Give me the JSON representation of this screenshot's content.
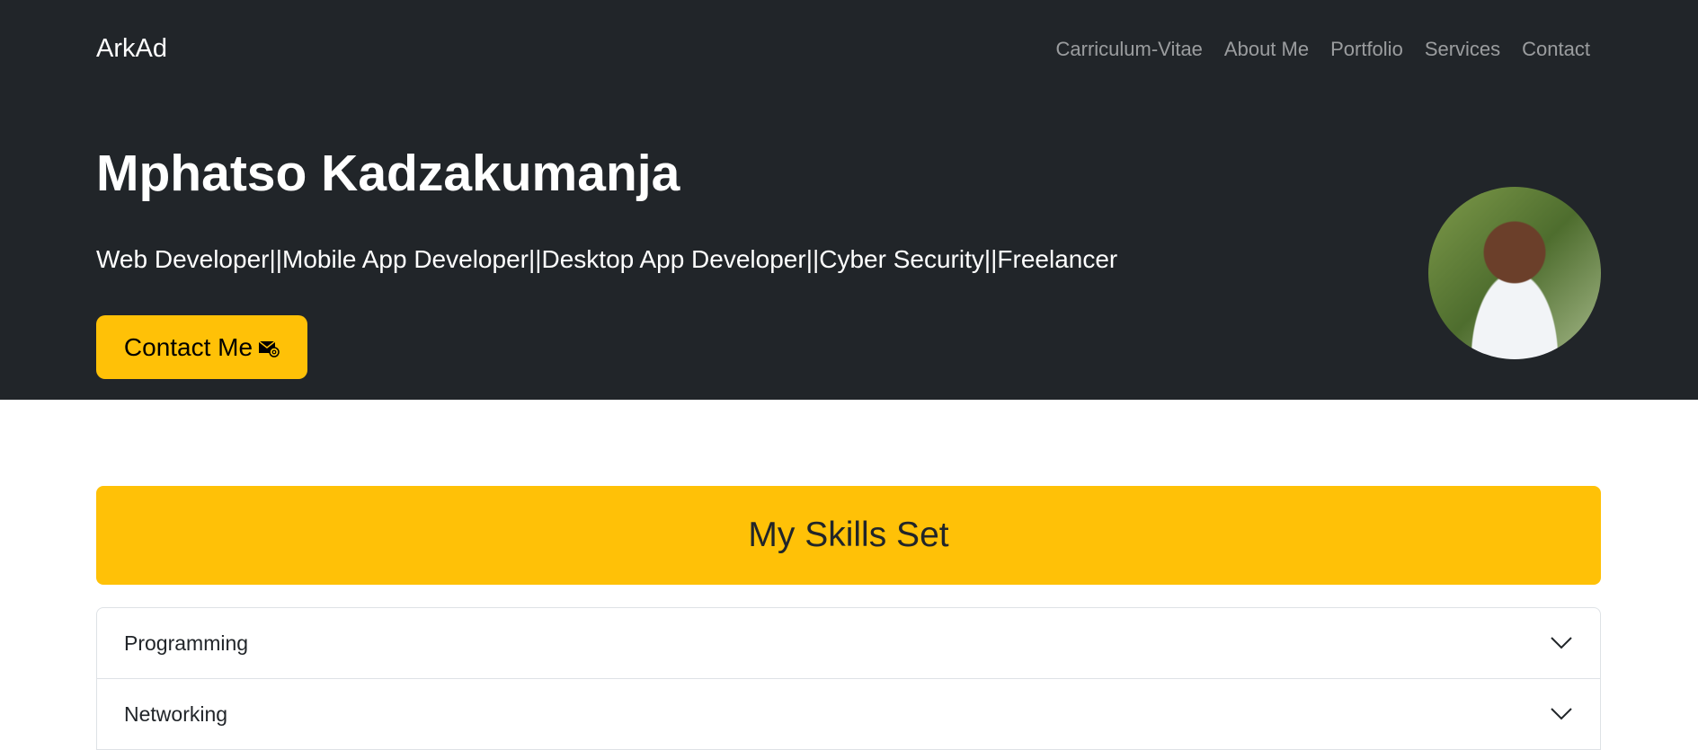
{
  "navbar": {
    "brand": "ArkAd",
    "links": [
      "Carriculum-Vitae",
      "About Me",
      "Portfolio",
      "Services",
      "Contact"
    ]
  },
  "hero": {
    "name": "Mphatso Kadzakumanja",
    "subtitle": "Web Developer||Mobile App Developer||Desktop App Developer||Cyber Security||Freelancer",
    "contact_button": "Contact Me",
    "contact_icon": "envelope-at-icon",
    "avatar_icon": "profile-photo"
  },
  "skills": {
    "title": "My Skills Set",
    "items": [
      {
        "label": "Programming"
      },
      {
        "label": "Networking"
      }
    ]
  },
  "colors": {
    "dark": "#212529",
    "accent": "#ffc107"
  }
}
